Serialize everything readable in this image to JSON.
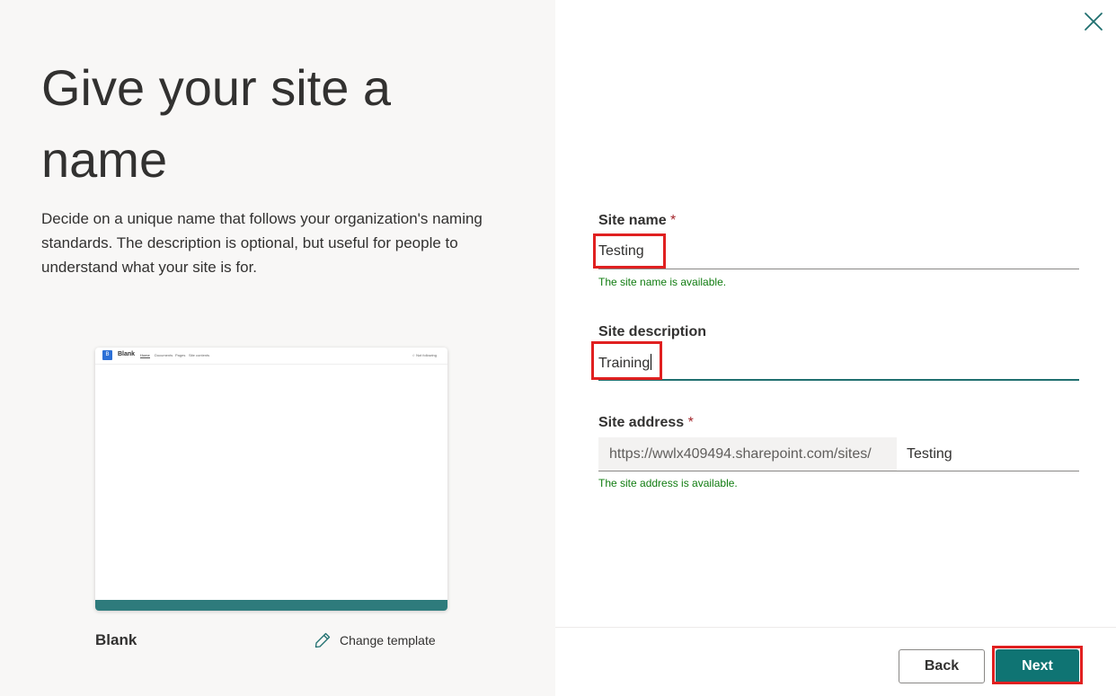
{
  "left_panel": {
    "title": "Give your site a name",
    "description": "Decide on a unique name that follows your organization's naming standards. The description is optional, but useful for people to understand what your site is for.",
    "template_name": "Blank",
    "change_template_label": "Change template",
    "preview": {
      "site_title": "Blank",
      "nav_items": [
        "Home",
        "Documents",
        "Pages",
        "Site contents"
      ],
      "follow_label": "☆ Not following"
    }
  },
  "form": {
    "site_name": {
      "label": "Site name",
      "required_mark": "*",
      "value": "Testing",
      "status": "The site name is available."
    },
    "site_description": {
      "label": "Site description",
      "value": "Training"
    },
    "site_address": {
      "label": "Site address",
      "required_mark": "*",
      "prefix": "https://wwlx409494.sharepoint.com/sites/",
      "value": "Testing",
      "status": "The site address is available."
    }
  },
  "buttons": {
    "back": "Back",
    "next": "Next"
  },
  "icons": {
    "close": "close-icon",
    "edit": "pencil-icon"
  },
  "colors": {
    "accent": "#0f7473",
    "success": "#107c10",
    "required": "#a4262c",
    "highlight": "#e02020",
    "left_panel_bg": "#f8f7f6"
  }
}
